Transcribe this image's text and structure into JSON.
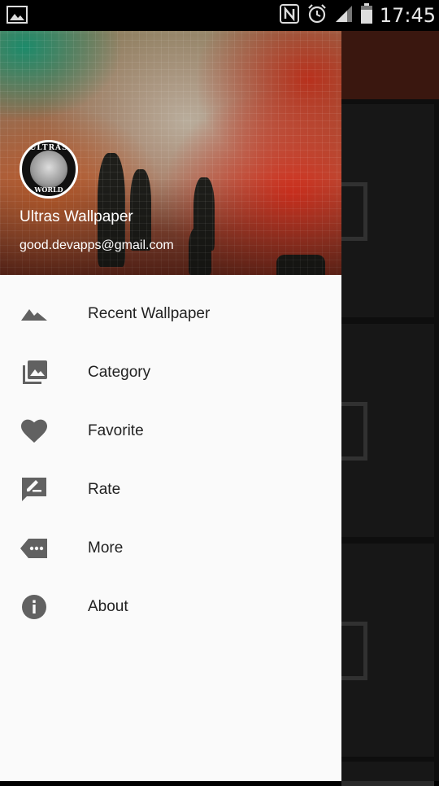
{
  "status_bar": {
    "time": "17:45",
    "icons": [
      "image-icon",
      "nfc-icon",
      "alarm-icon",
      "signal-icon",
      "battery-icon"
    ]
  },
  "drawer": {
    "header": {
      "logo_text_top": "ULTRAS",
      "logo_text_bottom": "WORLD",
      "app_name": "Ultras Wallpaper",
      "email": "good.devapps@gmail.com"
    },
    "items": [
      {
        "label": "Recent Wallpaper",
        "icon": "mountain-icon"
      },
      {
        "label": "Category",
        "icon": "photo-library-icon"
      },
      {
        "label": "Favorite",
        "icon": "heart-icon"
      },
      {
        "label": "Rate",
        "icon": "rate-review-icon"
      },
      {
        "label": "More",
        "icon": "more-tag-icon"
      },
      {
        "label": "About",
        "icon": "info-icon"
      }
    ]
  },
  "colors": {
    "icon_gray": "#616161",
    "toolbar": "#6a2a1c",
    "drawer_bg": "#fafafa"
  }
}
